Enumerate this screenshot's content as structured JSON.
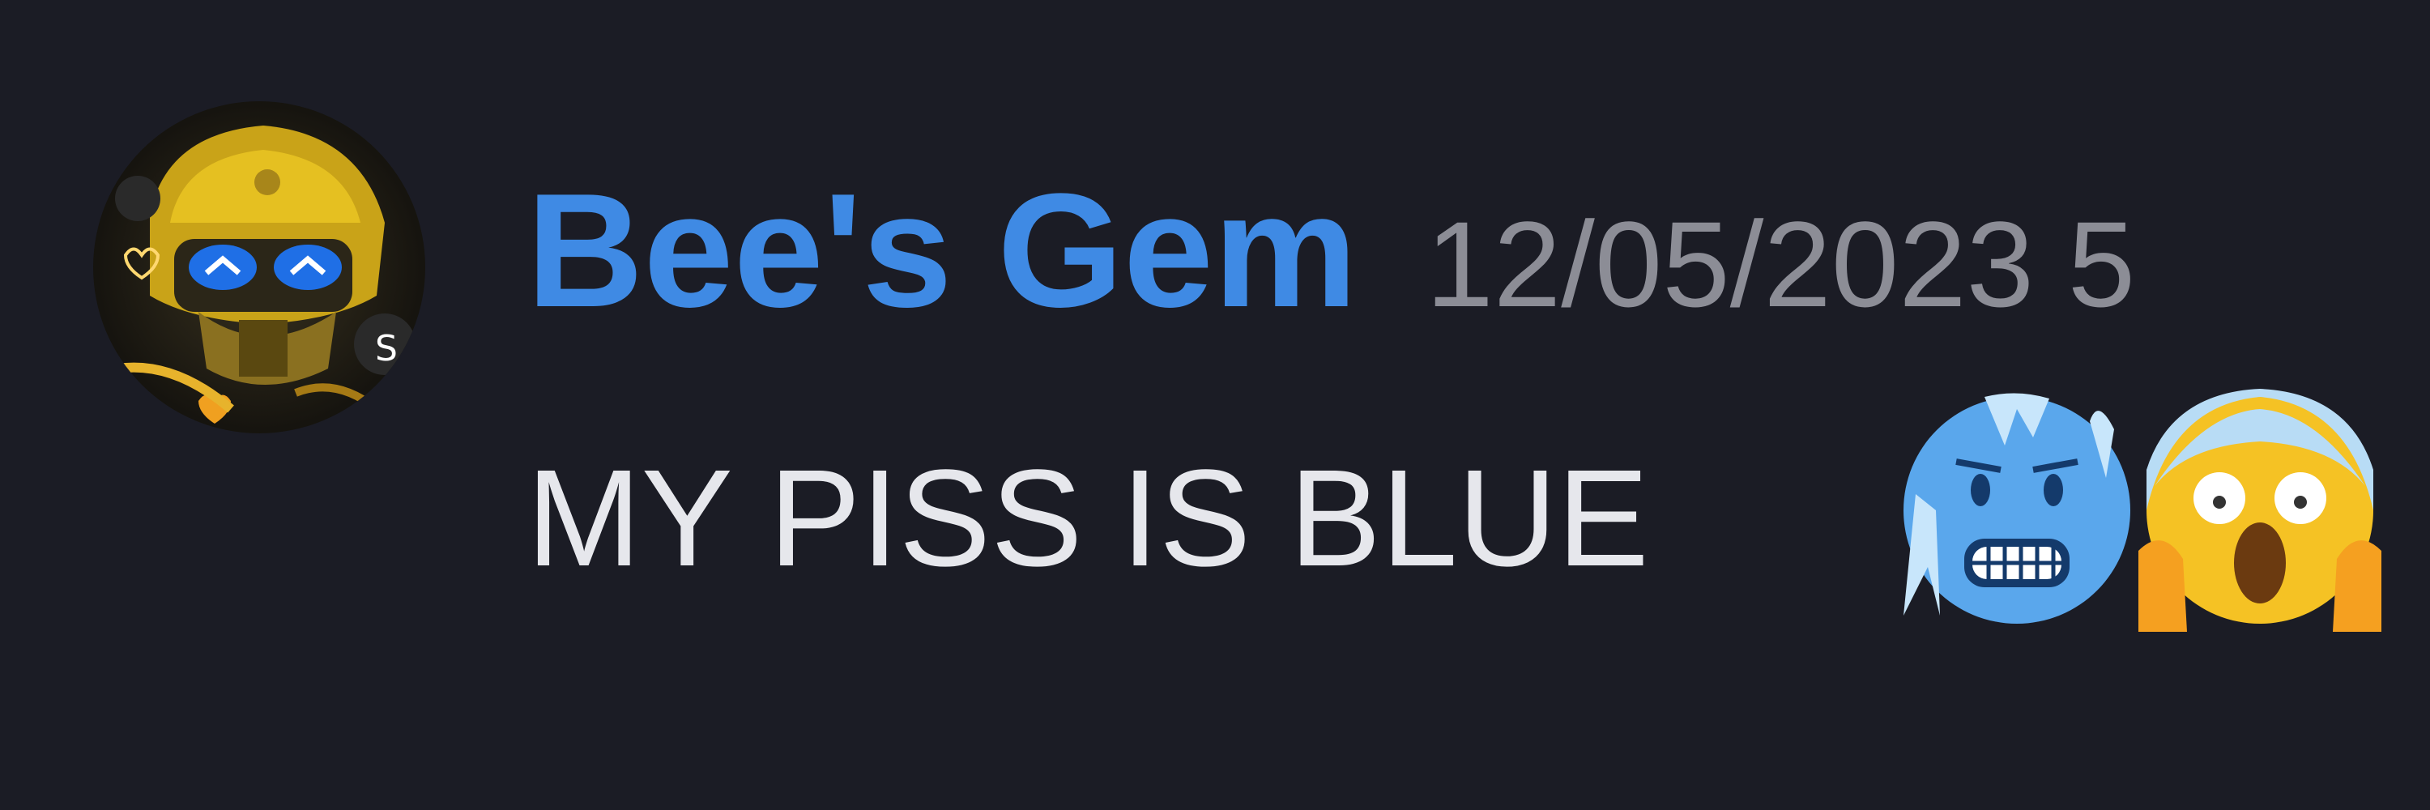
{
  "message": {
    "author": {
      "name": "Bee's Gem",
      "avatar_icon": "bumblebee-avatar",
      "name_color": "#3f8ae4"
    },
    "timestamp": "12/05/2023 5",
    "content": "MY PISS IS BLUE",
    "emojis": [
      {
        "name": "cold-face-emoji"
      },
      {
        "name": "face-screaming-in-fear-emoji"
      },
      {
        "name": "purple-emoji-partial"
      }
    ]
  },
  "colors": {
    "background": "#1b1c25",
    "text": "#e6e7ec",
    "timestamp": "#8c8d96",
    "username": "#3f8ae4"
  }
}
